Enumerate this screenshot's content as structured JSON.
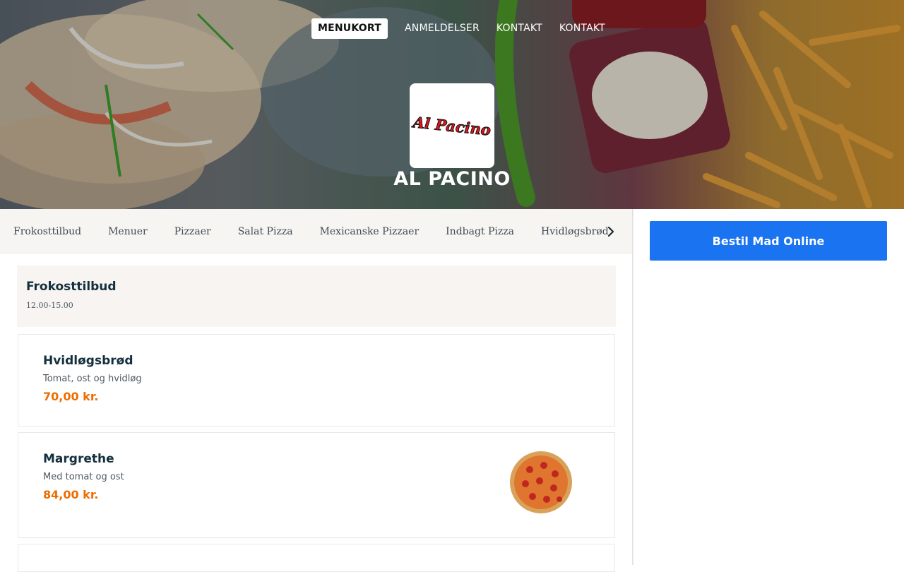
{
  "nav": {
    "items": [
      {
        "label": "MENUKORT",
        "active": true
      },
      {
        "label": "ANMELDELSER",
        "active": false
      },
      {
        "label": "KONTAKT",
        "active": false
      },
      {
        "label": "KONTAKT",
        "active": false
      }
    ]
  },
  "hero": {
    "logo_text": "Al Pacino",
    "restaurant_name": "AL PACINO"
  },
  "categories": [
    "Frokosttilbud",
    "Menuer",
    "Pizzaer",
    "Salat Pizza",
    "Mexicanske Pizzaer",
    "Indbagt Pizza",
    "Hvidløgsbrød"
  ],
  "category_next_icon": "chevron-right-icon",
  "order": {
    "label": "Bestil Mad Online"
  },
  "section": {
    "title": "Frokosttilbud",
    "hours": "12.00-15.00"
  },
  "items": [
    {
      "name": "Hvidløgsbrød",
      "description": "Tomat, ost og hvidløg",
      "price": "70,00 kr."
    },
    {
      "name": "Margrethe",
      "description": "Med tomat og ost",
      "price": "84,00 kr."
    }
  ],
  "colors": {
    "accent": "#1a73f0",
    "price": "#ef6c00",
    "heading": "#14303f",
    "logo_red": "#e3141b"
  }
}
